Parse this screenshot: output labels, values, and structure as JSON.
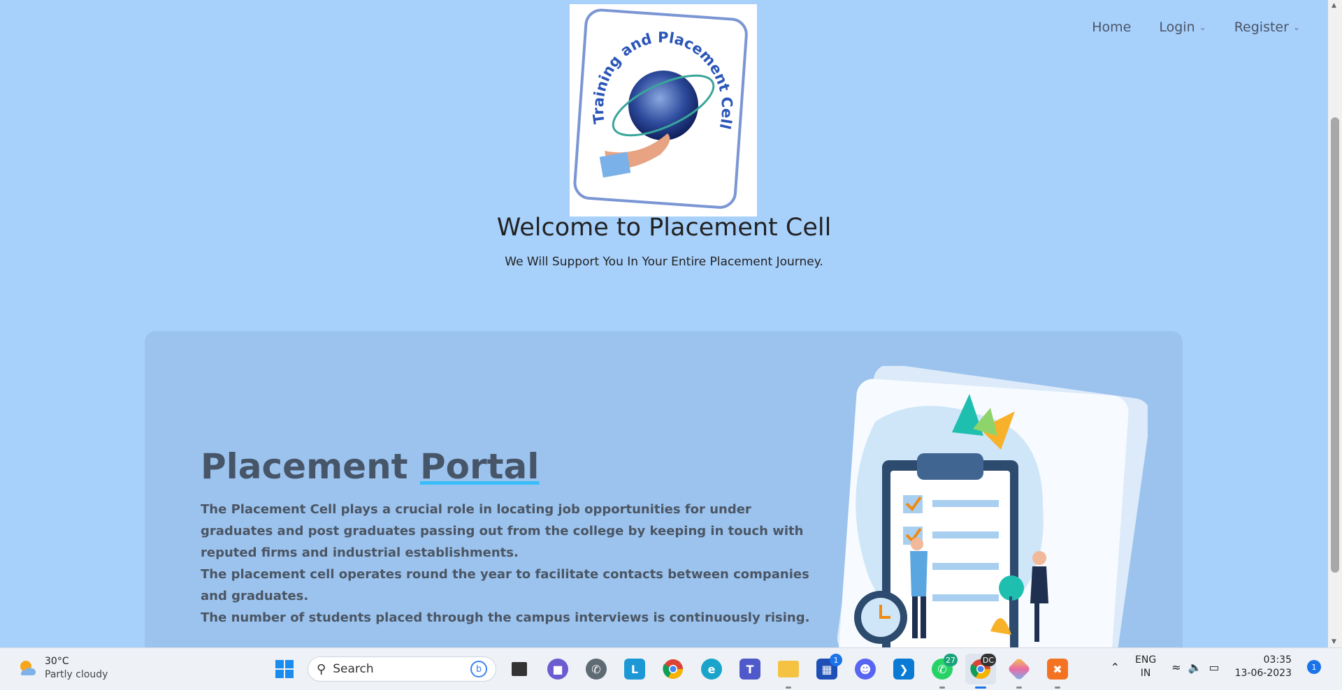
{
  "nav": {
    "home": "Home",
    "login": "Login",
    "register": "Register"
  },
  "logo": {
    "ring_text": "Training and Placement Cell"
  },
  "hero": {
    "title": "Welcome to Placement Cell",
    "subtitle": "We Will Support You In Your Entire Placement Journey."
  },
  "portal": {
    "title_part1": "Placement ",
    "title_part2": "Portal",
    "paragraph1": "The Placement Cell plays a crucial role in locating job opportunities for under graduates and post graduates passing out from the college by keeping in touch with reputed firms and industrial establishments.",
    "paragraph2": "The placement cell operates round the year to facilitate contacts between companies and graduates.",
    "paragraph3": "The number of students placed through the campus interviews is continuously rising."
  },
  "taskbar": {
    "weather": {
      "temp": "30°C",
      "desc": "Partly cloudy",
      "icon": "partly-cloudy-icon"
    },
    "search_placeholder": "Search",
    "apps": [
      {
        "name": "start",
        "icon": "windows-icon"
      },
      {
        "name": "task-view",
        "icon": "task-view-icon"
      },
      {
        "name": "meet",
        "icon": "video-call-icon"
      },
      {
        "name": "whatsapp",
        "icon": "whatsapp-icon"
      },
      {
        "name": "l-app",
        "icon": "l-app-icon",
        "label": "L"
      },
      {
        "name": "chrome",
        "icon": "chrome-icon"
      },
      {
        "name": "edge",
        "icon": "edge-icon"
      },
      {
        "name": "teams",
        "icon": "teams-icon"
      },
      {
        "name": "file-explorer",
        "icon": "folder-icon"
      },
      {
        "name": "store",
        "icon": "store-icon",
        "badge": "1"
      },
      {
        "name": "discord",
        "icon": "discord-icon"
      },
      {
        "name": "vscode",
        "icon": "vscode-icon"
      },
      {
        "name": "whatsapp-2",
        "icon": "whatsapp-icon",
        "badge": "27"
      },
      {
        "name": "chrome-2",
        "icon": "chrome-icon",
        "badge": "DC"
      },
      {
        "name": "paint",
        "icon": "paint-icon"
      },
      {
        "name": "xampp",
        "icon": "xampp-icon"
      }
    ],
    "tray": {
      "lang_top": "ENG",
      "lang_bottom": "IN",
      "time": "03:35",
      "date": "13-06-2023",
      "notifications": "1"
    }
  }
}
